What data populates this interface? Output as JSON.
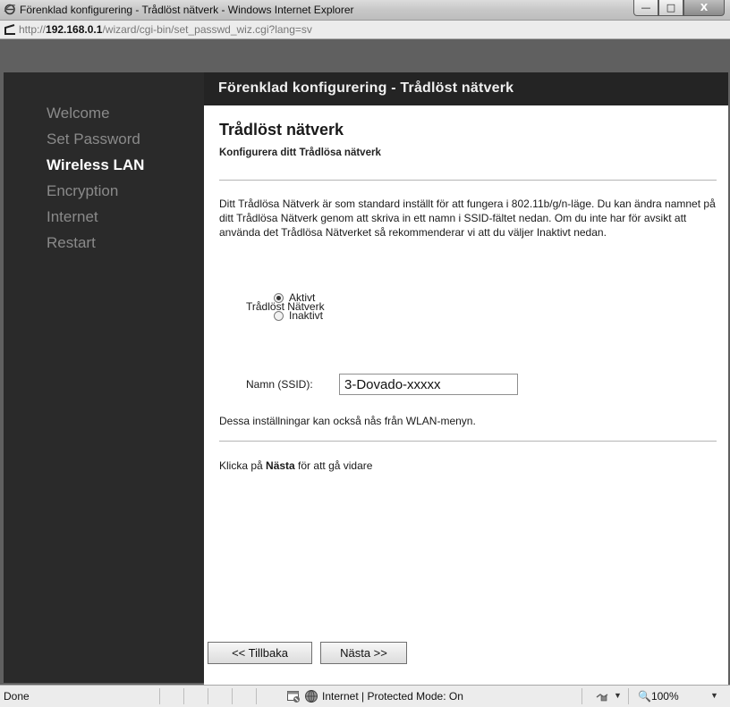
{
  "window": {
    "title": "Förenklad konfigurering - Trådlöst nätverk - Windows Internet Explorer",
    "url_prefix": "http://",
    "url_host": "192.168.0.1",
    "url_path": "/wizard/cgi-bin/set_passwd_wiz.cgi?lang=sv",
    "controls": {
      "minimize": "—",
      "maximize": "□",
      "close": "X"
    }
  },
  "sidebar": {
    "items": [
      {
        "label": "Welcome"
      },
      {
        "label": "Set Password"
      },
      {
        "label": "Wireless LAN"
      },
      {
        "label": "Encryption"
      },
      {
        "label": "Internet"
      },
      {
        "label": "Restart"
      }
    ],
    "active_index": 2
  },
  "header": {
    "title": "Förenklad konfigurering - Trådlöst nätverk"
  },
  "main": {
    "title": "Trådlöst nätverk",
    "subtitle": "Konfigurera ditt Trådlösa nätverk",
    "description": "Ditt Trådlösa Nätverk är som standard inställt för att fungera i 802.11b/g/n-läge. Du kan ändra namnet på ditt Trådlösa Nätverk genom att skriva in ett namn i SSID-fältet nedan. Om du inte har för avsikt att använda det Trådlösa Nätverket så rekommenderar vi att du väljer Inaktivt nedan.",
    "wireless_label": "Trådlöst Nätverk",
    "options": [
      {
        "label": "Aktivt",
        "checked": true
      },
      {
        "label": "Inaktivt",
        "checked": false
      }
    ],
    "ssid_label": "Namn (SSID):",
    "ssid_value": "3-Dovado-xxxxx",
    "note": "Dessa inställningar kan också nås från WLAN-menyn.",
    "next_prefix": "Klicka på ",
    "next_bold": "Nästa",
    "next_suffix": " för att gå vidare"
  },
  "buttons": {
    "back": "<< Tillbaka",
    "next": "Nästa >>"
  },
  "status": {
    "left": "Done",
    "zone": "Internet | Protected Mode: On",
    "zoom": "100%"
  },
  "colors": {
    "active_nav": "#ffffff",
    "inactive_nav": "#8a8a8a",
    "header_bg": "#242424",
    "sidebar_bg": "#2a2a2a"
  }
}
